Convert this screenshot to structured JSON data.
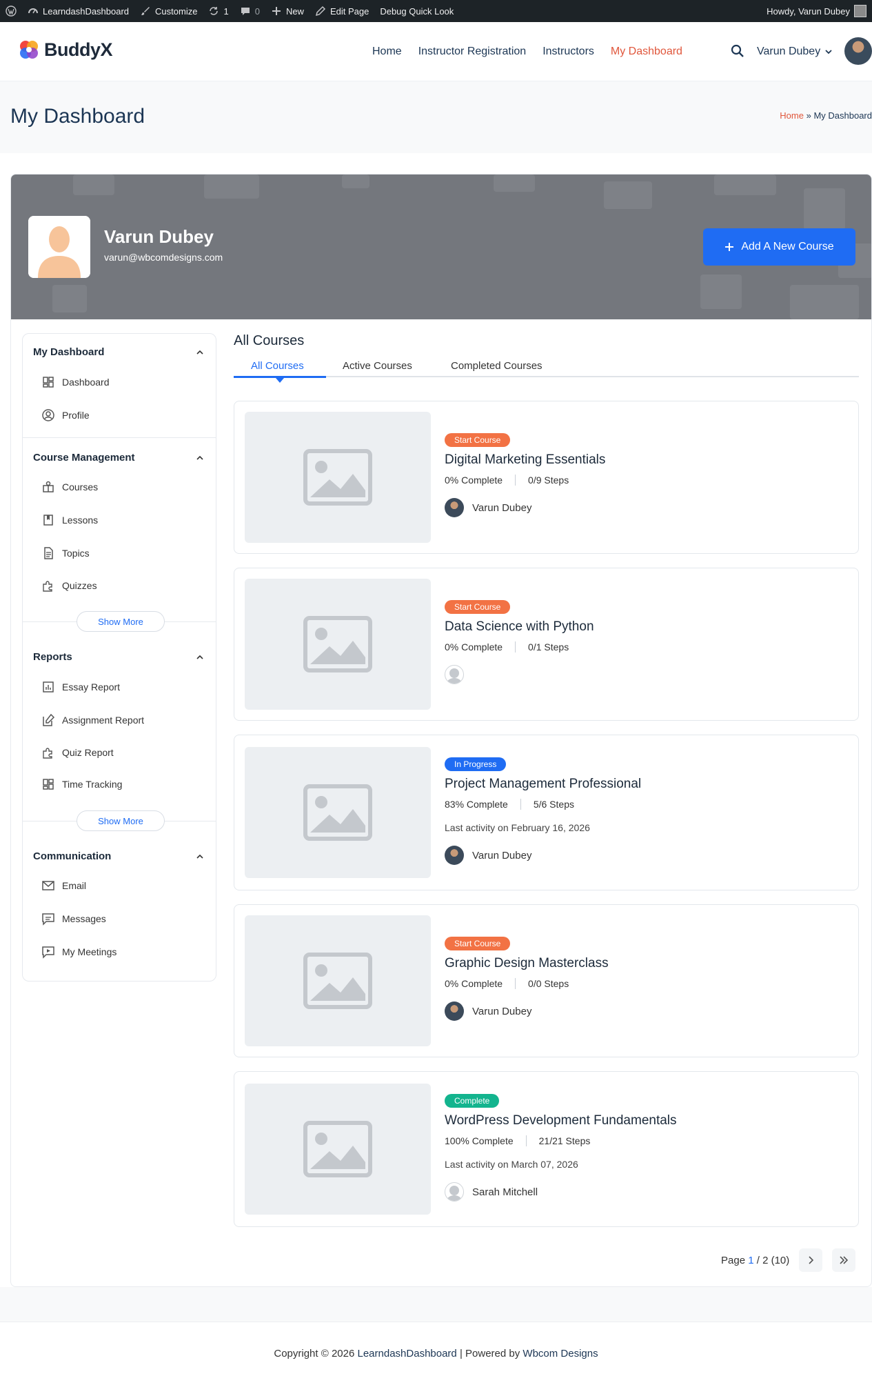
{
  "adminbar": {
    "site_name": "LearndashDashboard",
    "customize": "Customize",
    "updates_count": "1",
    "comments_count": "0",
    "new_label": "New",
    "edit_page": "Edit Page",
    "debug": "Debug Quick Look",
    "howdy": "Howdy, Varun Dubey"
  },
  "header": {
    "logo_text": "BuddyX",
    "nav": [
      "Home",
      "Instructor Registration",
      "Instructors",
      "My Dashboard"
    ],
    "user_name": "Varun Dubey"
  },
  "titlebar": {
    "title": "My Dashboard",
    "breadcrumb_home": "Home",
    "breadcrumb_sep": "»",
    "breadcrumb_current": "My Dashboard"
  },
  "profile": {
    "name": "Varun Dubey",
    "email": "varun@wbcomdesigns.com",
    "add_course_label": "Add A New Course"
  },
  "sidebar": {
    "sections": [
      {
        "title": "My Dashboard",
        "items": [
          "Dashboard",
          "Profile"
        ]
      },
      {
        "title": "Course Management",
        "items": [
          "Courses",
          "Lessons",
          "Topics",
          "Quizzes"
        ],
        "show_more": "Show More"
      },
      {
        "title": "Reports",
        "items": [
          "Essay Report",
          "Assignment Report",
          "Quiz Report",
          "Time Tracking"
        ],
        "show_more": "Show More"
      },
      {
        "title": "Communication",
        "items": [
          "Email",
          "Messages",
          "My Meetings"
        ]
      }
    ]
  },
  "content": {
    "title": "All Courses",
    "tabs": [
      "All Courses",
      "Active Courses",
      "Completed Courses"
    ],
    "courses": [
      {
        "badge": "Start Course",
        "title": "Digital Marketing Essentials",
        "complete": "0% Complete",
        "steps": "0/9 Steps",
        "activity": "",
        "author": "Varun Dubey"
      },
      {
        "badge": "Start Course",
        "title": "Data Science with Python",
        "complete": "0% Complete",
        "steps": "0/1 Steps",
        "activity": "",
        "author": ""
      },
      {
        "badge": "In Progress",
        "title": "Project Management Professional",
        "complete": "83% Complete",
        "steps": "5/6 Steps",
        "activity": "Last activity on February 16, 2026",
        "author": "Varun Dubey"
      },
      {
        "badge": "Start Course",
        "title": "Graphic Design Masterclass",
        "complete": "0% Complete",
        "steps": "0/0 Steps",
        "activity": "",
        "author": "Varun Dubey"
      },
      {
        "badge": "Complete",
        "title": "WordPress Development Fundamentals",
        "complete": "100% Complete",
        "steps": "21/21 Steps",
        "activity": "Last activity on March 07, 2026",
        "author": "Sarah Mitchell"
      }
    ],
    "pagination": {
      "label": "Page",
      "current": "1",
      "rest": "/ 2 (10)"
    }
  },
  "footer": {
    "prefix": "Copyright © 2026",
    "site_link": "LearndashDashboard",
    "middle": "| Powered by",
    "company_link": "Wbcom Designs"
  },
  "colors": {
    "accent_blue": "#1f6cf3",
    "nav_active": "#e0563b",
    "badge_start": "#f27244",
    "badge_progress": "#1f6cf3",
    "badge_complete": "#13b48e"
  }
}
